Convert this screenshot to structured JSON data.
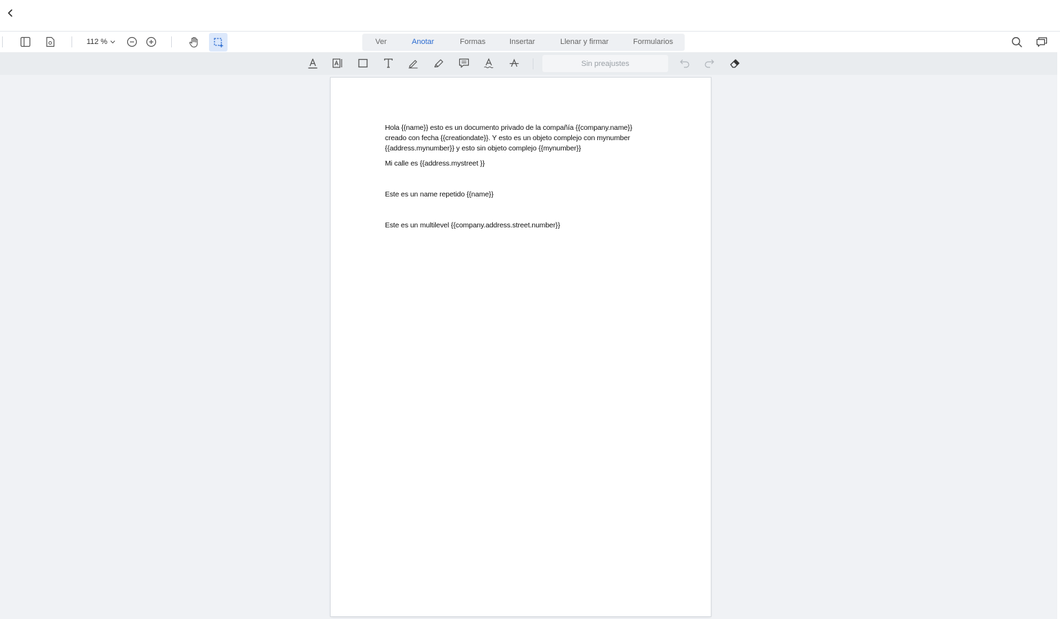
{
  "toolbar": {
    "zoom_label": "112 %",
    "tabs": [
      {
        "label": "Ver"
      },
      {
        "label": "Anotar",
        "active": true
      },
      {
        "label": "Formas"
      },
      {
        "label": "Insertar"
      },
      {
        "label": "Llenar y firmar"
      },
      {
        "label": "Formularios"
      }
    ],
    "accent_color": "#2c6cd1"
  },
  "annotate_toolbar": {
    "tools": [
      "text-highlight-icon",
      "free-text-box-icon",
      "rectangle-icon",
      "text-icon",
      "pen-icon",
      "highlighter-icon",
      "comment-icon",
      "underline-icon",
      "strikethrough-icon"
    ],
    "preset_label": "Sin preajustes"
  },
  "document": {
    "paragraph1": [
      "Hola {{name}} esto es un documento privado de la compañía {{company.name}}",
      "creado con fecha {{creationdate}}. Y esto es un objeto complejo con mynumber",
      "{{address.mynumber}} y esto sin objeto complejo {{mynumber}}"
    ],
    "line2": "Mi calle es {{address.mystreet }}",
    "line3": "Este es un name repetido {{name}}",
    "line4": "Este es un multilevel {{company.address.street.number}}"
  }
}
